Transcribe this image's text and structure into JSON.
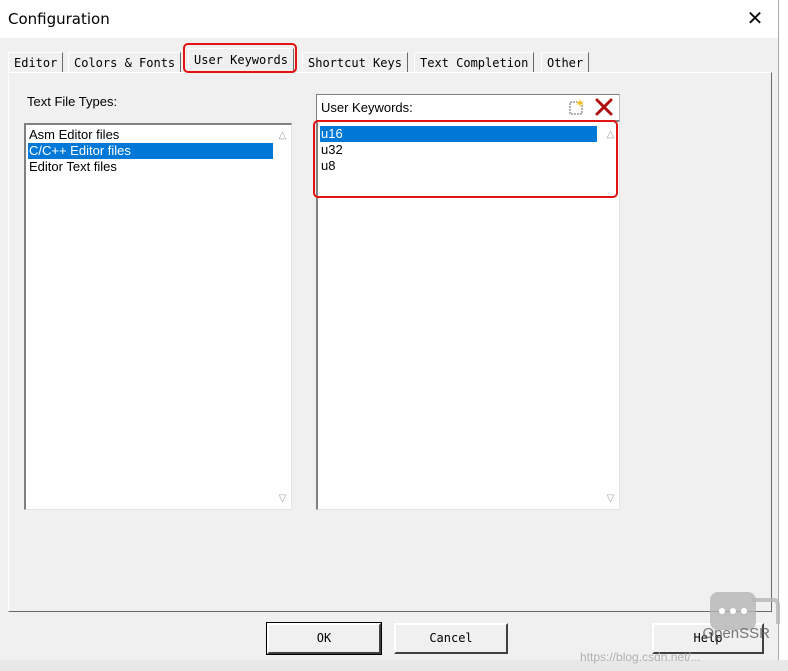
{
  "window": {
    "title": "Configuration",
    "close_glyph": "✕"
  },
  "tabs": [
    {
      "label": "Editor",
      "active": false
    },
    {
      "label": "Colors & Fonts",
      "active": false
    },
    {
      "label": "User Keywords",
      "active": true
    },
    {
      "label": "Shortcut Keys",
      "active": false
    },
    {
      "label": "Text Completion",
      "active": false
    },
    {
      "label": "Other",
      "active": false
    }
  ],
  "file_types": {
    "label": "Text File Types:",
    "items": [
      "Asm Editor files",
      "C/C++ Editor files",
      "Editor Text files"
    ],
    "selected_index": 1
  },
  "keywords": {
    "label": "User Keywords:",
    "new_icon": "new-item-icon",
    "delete_icon": "delete-x-icon",
    "items": [
      "u16",
      "u32",
      "u8"
    ],
    "selected_index": 0
  },
  "buttons": {
    "ok": "OK",
    "cancel": "Cancel",
    "help": "Help"
  },
  "watermark": {
    "text": "OpenSSR",
    "url": "https://blog.csdn.net/..."
  },
  "colors": {
    "selection": "#0078d7",
    "highlight_box": "#e21414"
  }
}
